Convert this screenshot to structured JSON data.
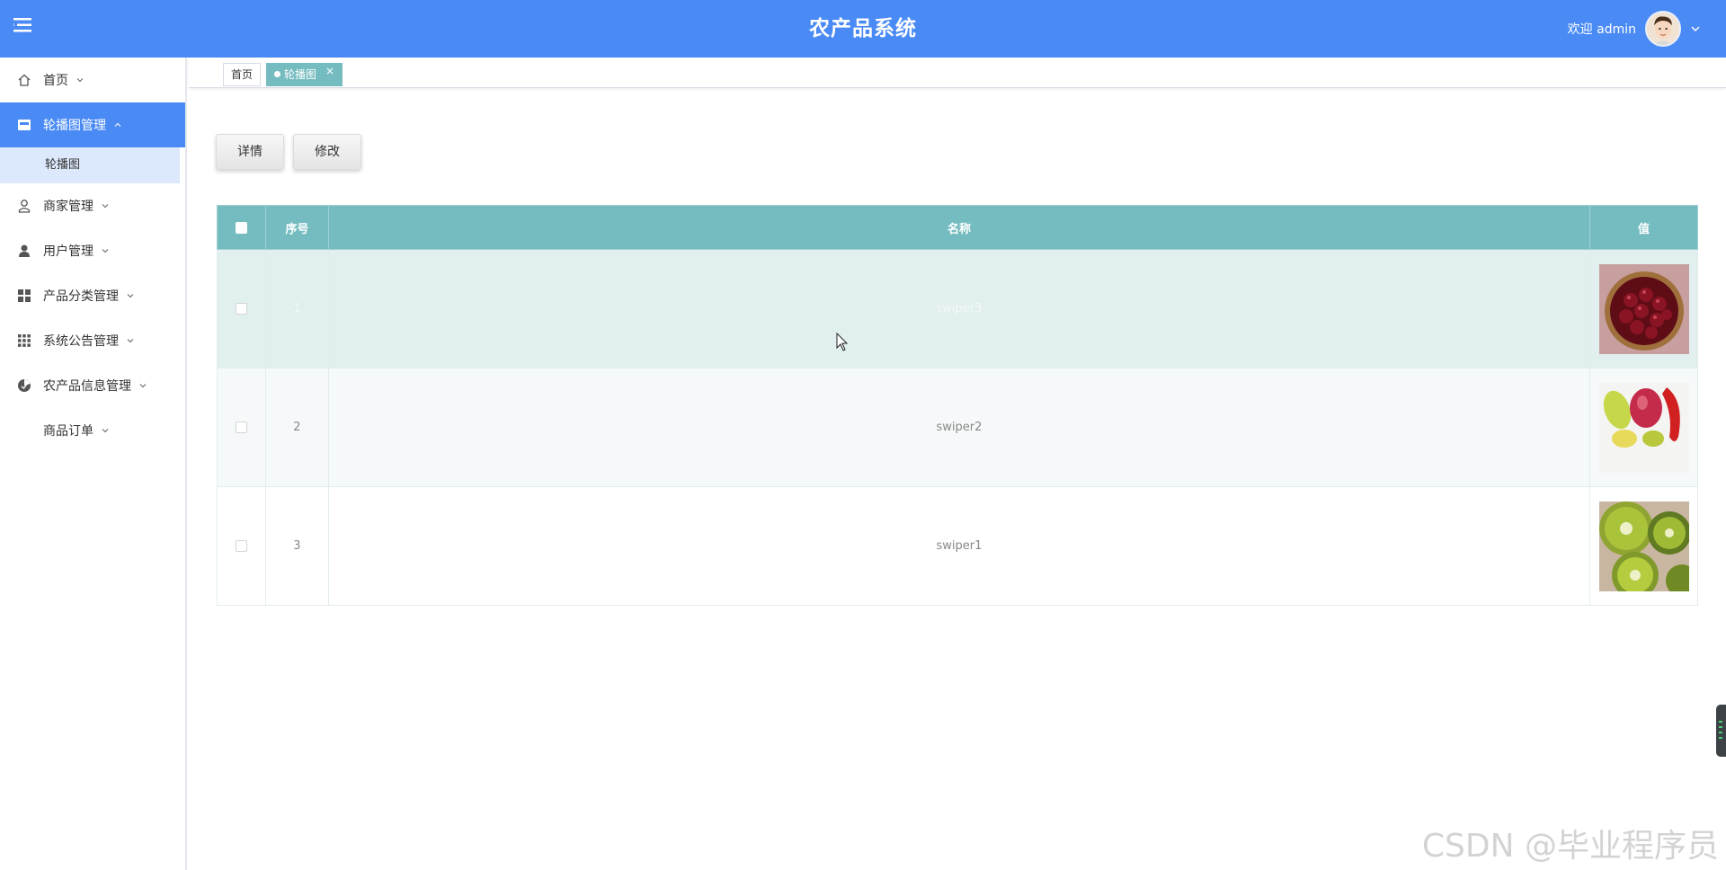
{
  "header": {
    "title": "农产品系统",
    "welcome": "欢迎 admin",
    "menu_icon": "hamburger-icon",
    "avatar_icon": "user-avatar",
    "color": "#4a8af4"
  },
  "sidebar": {
    "items": [
      {
        "label": "首页",
        "icon": "home-icon"
      },
      {
        "label": "轮播图管理",
        "icon": "image-icon",
        "active": true
      },
      {
        "label": "商家管理",
        "icon": "user-outline-icon"
      },
      {
        "label": "用户管理",
        "icon": "user-solid-icon"
      },
      {
        "label": "产品分类管理",
        "icon": "grid-icon"
      },
      {
        "label": "系统公告管理",
        "icon": "apps-icon"
      },
      {
        "label": "农产品信息管理",
        "icon": "pie-icon"
      },
      {
        "label": "商品订单",
        "icon": ""
      }
    ],
    "submenu": {
      "label": "轮播图"
    },
    "active_color": "#4a8af4"
  },
  "tabs": [
    {
      "label": "首页"
    },
    {
      "label": "轮播图",
      "active": true
    }
  ],
  "toolbar": {
    "detail_label": "详情",
    "edit_label": "修改"
  },
  "table": {
    "columns": [
      "序号",
      "名称",
      "值"
    ],
    "rows": [
      {
        "index": "1",
        "name": "swiper3",
        "image": "cherries"
      },
      {
        "index": "2",
        "name": "swiper2",
        "image": "peppers"
      },
      {
        "index": "3",
        "name": "swiper1",
        "image": "kiwi"
      }
    ],
    "header_color": "#75bcc0"
  },
  "watermark": "CSDN @毕业程序员"
}
